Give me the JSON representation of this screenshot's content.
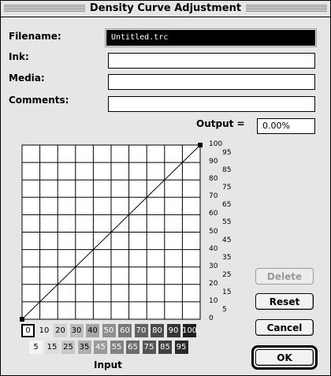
{
  "window": {
    "title": "Density Curve Adjustment"
  },
  "form": {
    "filename_label": "Filename:",
    "filename_value": "Untitled.trc",
    "ink_label": "Ink:",
    "ink_value": "",
    "media_label": "Media:",
    "media_value": "",
    "comments_label": "Comments:",
    "comments_value": ""
  },
  "output": {
    "label": "Output =",
    "value": "0.00%"
  },
  "curve": {
    "right_scale_major": [
      "100",
      "90",
      "80",
      "70",
      "60",
      "50",
      "40",
      "30",
      "20",
      "10",
      "0"
    ],
    "right_scale_minor": [
      "95",
      "85",
      "75",
      "65",
      "55",
      "45",
      "35",
      "25",
      "15",
      "5"
    ]
  },
  "input": {
    "label": "Input",
    "row1": [
      "0",
      "10",
      "20",
      "30",
      "40",
      "50",
      "60",
      "70",
      "80",
      "90",
      "100"
    ],
    "row2": [
      "5",
      "15",
      "25",
      "35",
      "45",
      "55",
      "65",
      "75",
      "85",
      "95"
    ]
  },
  "buttons": {
    "delete": "Delete",
    "reset": "Reset",
    "cancel": "Cancel",
    "ok": "OK"
  }
}
